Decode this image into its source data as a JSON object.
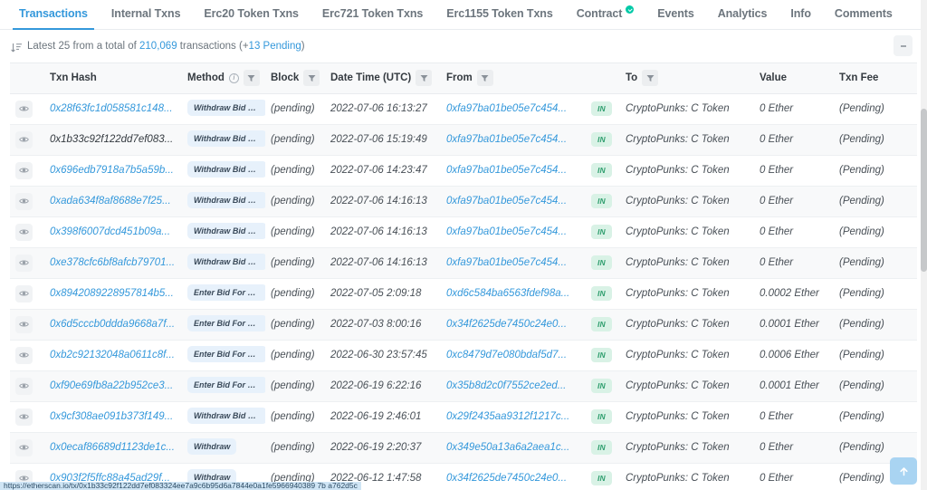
{
  "tabs": [
    {
      "label": "Transactions",
      "active": true,
      "verified": false
    },
    {
      "label": "Internal Txns",
      "active": false,
      "verified": false
    },
    {
      "label": "Erc20 Token Txns",
      "active": false,
      "verified": false
    },
    {
      "label": "Erc721 Token Txns",
      "active": false,
      "verified": false
    },
    {
      "label": "Erc1155 Token Txns",
      "active": false,
      "verified": false
    },
    {
      "label": "Contract",
      "active": false,
      "verified": true
    },
    {
      "label": "Events",
      "active": false,
      "verified": false
    },
    {
      "label": "Analytics",
      "active": false,
      "verified": false
    },
    {
      "label": "Info",
      "active": false,
      "verified": false
    },
    {
      "label": "Comments",
      "active": false,
      "verified": false
    }
  ],
  "summary": {
    "prefix": "Latest 25 from a total of ",
    "total": "210,069",
    "middle": " transactions (+",
    "pending": "13 Pending",
    "suffix": ")",
    "sort_icon": "sort-descending-icon",
    "menu_icon": "kebab-menu-icon"
  },
  "table": {
    "columns": [
      {
        "label": "",
        "key": "eye",
        "filter": false,
        "info": false,
        "link": false
      },
      {
        "label": "Txn Hash",
        "key": "hash",
        "filter": false,
        "info": false,
        "link": false
      },
      {
        "label": "Method",
        "key": "method",
        "filter": true,
        "info": true,
        "link": false
      },
      {
        "label": "Block",
        "key": "block",
        "filter": true,
        "info": false,
        "link": false
      },
      {
        "label": "Date Time (UTC)",
        "key": "datetime",
        "filter": true,
        "info": false,
        "link": true
      },
      {
        "label": "From",
        "key": "from",
        "filter": true,
        "info": false,
        "link": false
      },
      {
        "label": "",
        "key": "direction",
        "filter": false,
        "info": false,
        "link": false
      },
      {
        "label": "To",
        "key": "to",
        "filter": true,
        "info": false,
        "link": false
      },
      {
        "label": "Value",
        "key": "value",
        "filter": false,
        "info": false,
        "link": false
      },
      {
        "label": "Txn Fee",
        "key": "fee",
        "filter": false,
        "info": false,
        "link": true
      }
    ],
    "rows": [
      {
        "hash": "0x28f63fc1d058581c148...",
        "method": "Withdraw Bid For...",
        "block": "(pending)",
        "datetime": "2022-07-06 16:13:27",
        "from": "0xfa97ba01be05e7c454...",
        "direction": "IN",
        "to": "CryptoPunks: C Token",
        "value": "0 Ether",
        "fee": "(Pending)",
        "hovered": false
      },
      {
        "hash": "0x1b33c92f122dd7ef083...",
        "method": "Withdraw Bid For...",
        "block": "(pending)",
        "datetime": "2022-07-06 15:19:49",
        "from": "0xfa97ba01be05e7c454...",
        "direction": "IN",
        "to": "CryptoPunks: C Token",
        "value": "0 Ether",
        "fee": "(Pending)",
        "hovered": true
      },
      {
        "hash": "0x696edb7918a7b5a59b...",
        "method": "Withdraw Bid For...",
        "block": "(pending)",
        "datetime": "2022-07-06 14:23:47",
        "from": "0xfa97ba01be05e7c454...",
        "direction": "IN",
        "to": "CryptoPunks: C Token",
        "value": "0 Ether",
        "fee": "(Pending)",
        "hovered": false
      },
      {
        "hash": "0xada634f8af8688e7f25...",
        "method": "Withdraw Bid For...",
        "block": "(pending)",
        "datetime": "2022-07-06 14:16:13",
        "from": "0xfa97ba01be05e7c454...",
        "direction": "IN",
        "to": "CryptoPunks: C Token",
        "value": "0 Ether",
        "fee": "(Pending)",
        "hovered": false
      },
      {
        "hash": "0x398f6007dcd451b09a...",
        "method": "Withdraw Bid For...",
        "block": "(pending)",
        "datetime": "2022-07-06 14:16:13",
        "from": "0xfa97ba01be05e7c454...",
        "direction": "IN",
        "to": "CryptoPunks: C Token",
        "value": "0 Ether",
        "fee": "(Pending)",
        "hovered": false
      },
      {
        "hash": "0xe378cfc6bf8afcb79701...",
        "method": "Withdraw Bid For...",
        "block": "(pending)",
        "datetime": "2022-07-06 14:16:13",
        "from": "0xfa97ba01be05e7c454...",
        "direction": "IN",
        "to": "CryptoPunks: C Token",
        "value": "0 Ether",
        "fee": "(Pending)",
        "hovered": false
      },
      {
        "hash": "0x8942089228957814b5...",
        "method": "Enter Bid For Pu...",
        "block": "(pending)",
        "datetime": "2022-07-05 2:09:18",
        "from": "0xd6c584ba6563fdef98a...",
        "direction": "IN",
        "to": "CryptoPunks: C Token",
        "value": "0.0002 Ether",
        "fee": "(Pending)",
        "hovered": false
      },
      {
        "hash": "0x6d5cccb0ddda9668a7f...",
        "method": "Enter Bid For Pu...",
        "block": "(pending)",
        "datetime": "2022-07-03 8:00:16",
        "from": "0x34f2625de7450c24e0...",
        "direction": "IN",
        "to": "CryptoPunks: C Token",
        "value": "0.0001 Ether",
        "fee": "(Pending)",
        "hovered": false
      },
      {
        "hash": "0xb2c92132048a0611c8f...",
        "method": "Enter Bid For Pu...",
        "block": "(pending)",
        "datetime": "2022-06-30 23:57:45",
        "from": "0xc8479d7e080bdaf5d7...",
        "direction": "IN",
        "to": "CryptoPunks: C Token",
        "value": "0.0006 Ether",
        "fee": "(Pending)",
        "hovered": false
      },
      {
        "hash": "0xf90e69fb8a22b952ce3...",
        "method": "Enter Bid For Pu...",
        "block": "(pending)",
        "datetime": "2022-06-19 6:22:16",
        "from": "0x35b8d2c0f7552ce2ed...",
        "direction": "IN",
        "to": "CryptoPunks: C Token",
        "value": "0.0001 Ether",
        "fee": "(Pending)",
        "hovered": false
      },
      {
        "hash": "0x9cf308ae091b373f149...",
        "method": "Withdraw Bid For...",
        "block": "(pending)",
        "datetime": "2022-06-19 2:46:01",
        "from": "0x29f2435aa9312f1217c...",
        "direction": "IN",
        "to": "CryptoPunks: C Token",
        "value": "0 Ether",
        "fee": "(Pending)",
        "hovered": false
      },
      {
        "hash": "0x0ecaf86689d1123de1c...",
        "method": "Withdraw",
        "block": "(pending)",
        "datetime": "2022-06-19 2:20:37",
        "from": "0x349e50a13a6a2aea1c...",
        "direction": "IN",
        "to": "CryptoPunks: C Token",
        "value": "0 Ether",
        "fee": "(Pending)",
        "hovered": false
      },
      {
        "hash": "0x903f2f5ffc88a45ad29f...",
        "method": "Withdraw",
        "block": "(pending)",
        "datetime": "2022-06-12 1:47:58",
        "from": "0x34f2625de7450c24e0...",
        "direction": "IN",
        "to": "CryptoPunks: C Token",
        "value": "0 Ether",
        "fee": "(Pending)",
        "hovered": false
      }
    ]
  },
  "scroll_top": {
    "icon": "arrow-up-icon"
  },
  "status_bar": {
    "text": "https://etherscan.io/tx/0x1b33c92f122dd7ef083324ee7a9c6b95d6a7844e0a1fe5966940389 7b a762d5c"
  },
  "colors": {
    "accent": "#3498db",
    "verified": "#00c9a7",
    "in_badge_bg": "#d9f2e6",
    "in_badge_text": "#2f9e6e",
    "method_badge_bg": "#e7f1fb",
    "alt_row": "#f8f9fa"
  }
}
